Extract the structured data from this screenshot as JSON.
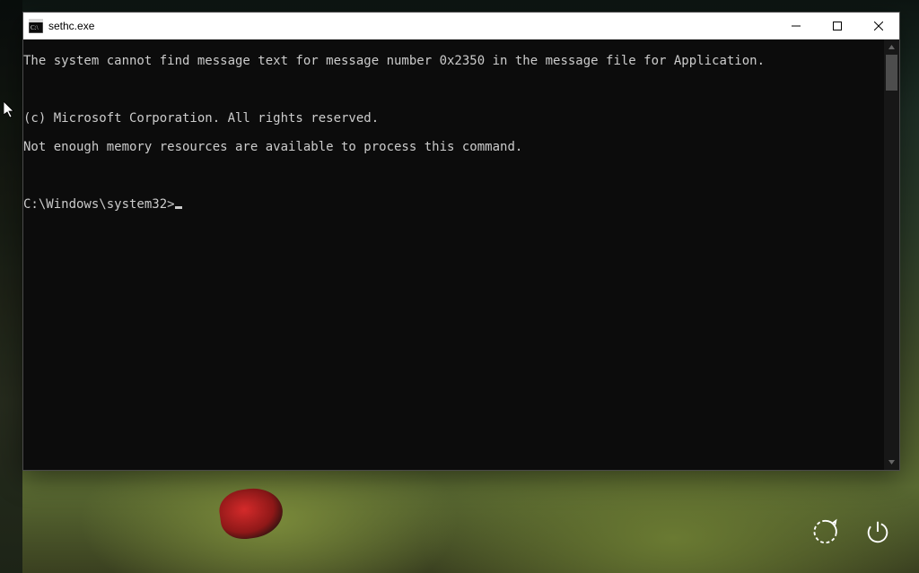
{
  "window": {
    "title": "sethc.exe"
  },
  "console": {
    "lines": [
      "The system cannot find message text for message number 0x2350 in the message file for Application.",
      "",
      "(c) Microsoft Corporation. All rights reserved.",
      "Not enough memory resources are available to process this command.",
      ""
    ],
    "prompt": "C:\\Windows\\system32>"
  }
}
